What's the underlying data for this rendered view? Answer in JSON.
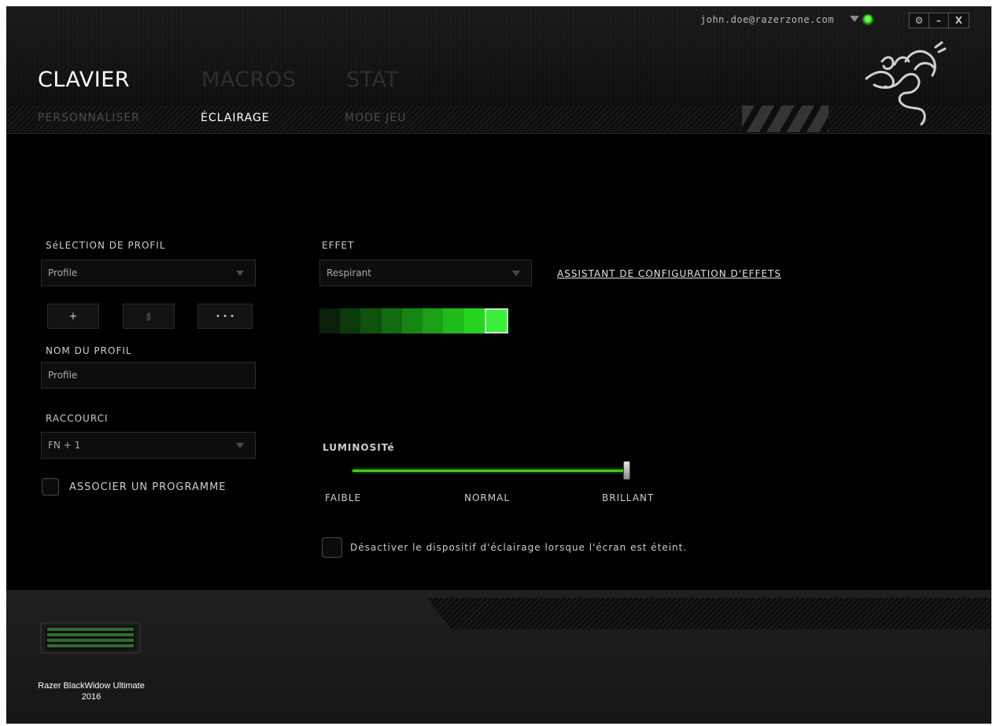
{
  "account": {
    "email": "john.doe@razerzone.com"
  },
  "window_buttons": {
    "settings": "⚙",
    "minimize": "–",
    "close": "X"
  },
  "main_tabs": [
    "CLAVIER",
    "MACROS",
    "STAT"
  ],
  "sub_tabs": [
    "PERSONNALISER",
    "ÉCLAIRAGE",
    "MODE JEU"
  ],
  "profile": {
    "selection_label": "SéLECTION DE PROFIL",
    "selected_profile": "Profile",
    "add_button": "+",
    "delete_button": "▮",
    "more_button": "• • •",
    "name_label": "NOM DU PROFIL",
    "name_value": "Profile",
    "shortcut_label": "RACCOURCI",
    "shortcut_value": "FN + 1",
    "link_program_label": "ASSOCIER UN PROGRAMME"
  },
  "effect": {
    "label": "EFFET",
    "selected": "Respirant",
    "wizard_link": "ASSISTANT DE CONFIGURATION D'EFFETS",
    "palette": [
      "#0a200a",
      "#0b3a0b",
      "#0e520e",
      "#126b10",
      "#168512",
      "#1aa016",
      "#1fbb1a",
      "#25d41e",
      "#3bf03a"
    ]
  },
  "brightness": {
    "label": "LUMINOSITé",
    "level": 1.0,
    "ticks": [
      "FAIBLE",
      "NORMAL",
      "BRILLANT"
    ]
  },
  "screen_off_option": "Désactiver le dispositif d'éclairage lorsque l'écran est éteint.",
  "device": {
    "name_line1": "Razer BlackWidow Ultimate",
    "name_line2": "2016"
  },
  "colors": {
    "accent": "#44d62c"
  }
}
